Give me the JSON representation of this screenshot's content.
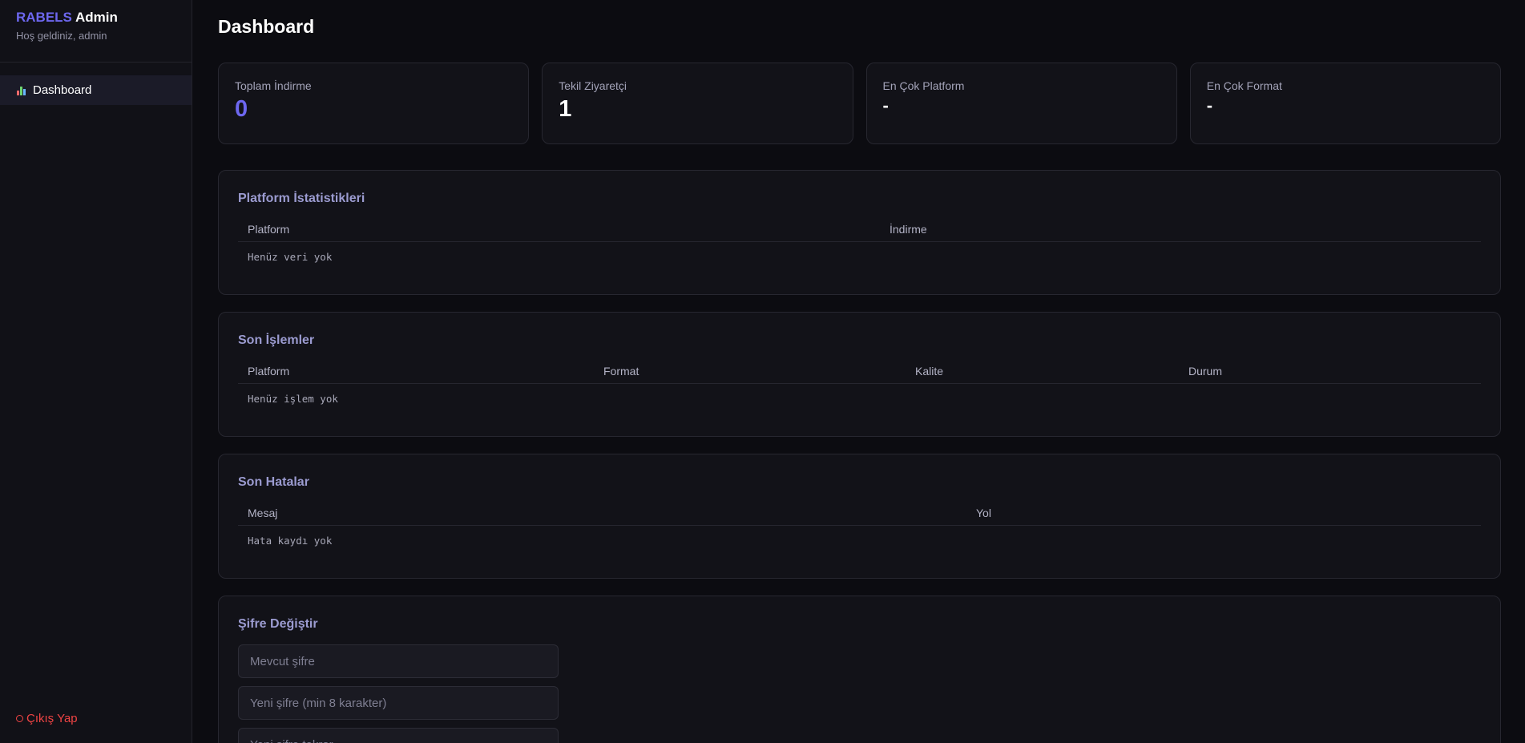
{
  "sidebar": {
    "brand_accent": "RABELS",
    "brand_main": "Admin",
    "welcome": "Hoş geldiniz, admin",
    "nav": [
      {
        "label": "Dashboard",
        "icon": "bar-chart-icon"
      }
    ],
    "logout_label": "Çıkış Yap"
  },
  "main": {
    "title": "Dashboard",
    "stats": [
      {
        "label": "Toplam İndirme",
        "value": "0"
      },
      {
        "label": "Tekil Ziyaretçi",
        "value": "1"
      },
      {
        "label": "En Çok Platform",
        "value": "-"
      },
      {
        "label": "En Çok Format",
        "value": "-"
      }
    ],
    "platform_stats": {
      "title": "Platform İstatistikleri",
      "columns": [
        "Platform",
        "İndirme"
      ],
      "empty": "Henüz veri yok"
    },
    "recent_ops": {
      "title": "Son İşlemler",
      "columns": [
        "Platform",
        "Format",
        "Kalite",
        "Durum"
      ],
      "empty": "Henüz işlem yok"
    },
    "recent_errors": {
      "title": "Son Hatalar",
      "columns": [
        "Mesaj",
        "Yol"
      ],
      "empty": "Hata kaydı yok"
    },
    "password_change": {
      "title": "Şifre Değiştir",
      "current_placeholder": "Mevcut şifre",
      "new_placeholder": "Yeni şifre (min 8 karakter)",
      "repeat_placeholder": "Yeni şifre tekrar"
    }
  },
  "colors": {
    "accent": "#6d67ef",
    "danger": "#ef4444",
    "background": "#0c0c11"
  }
}
